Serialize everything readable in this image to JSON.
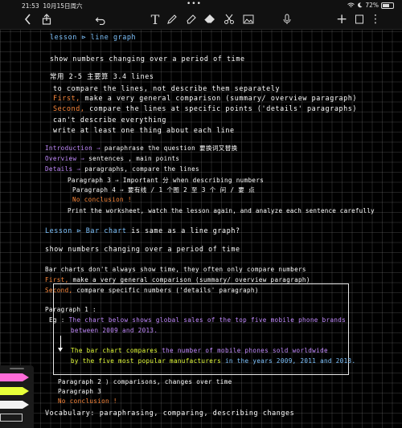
{
  "status": {
    "time": "21:53",
    "date": "10月15日周六",
    "battery": "72%"
  },
  "toolbar": {
    "back_icon": "chevron-left-icon",
    "share_icon": "share-icon",
    "undo_icon": "undo-icon",
    "dots": "•••",
    "text_tool": "T",
    "plus": "+",
    "more": "⋮",
    "page_icon": "square-icon"
  },
  "note": {
    "l1": "lesson ⊳   line graph",
    "l2": "show numbers changing over a period of time",
    "l3": "常用 2-5 主要算 3.4 lines",
    "l4": "to compare the lines, not describe them separately",
    "l5_a": "First,",
    "l5_b": "make a very general comparison (summary/ overview paragraph)",
    "l6_a": "Second,",
    "l6_b": "compare the lines at specific points  ('details' paragraphs)",
    "l7": "can't describe  everything",
    "l8": "write at least one thing  about each line",
    "l9_a": "Introduction ⇒",
    "l9_b": "paraphrase the question  要换词又替换",
    "l10_a": "Overview ⇒",
    "l10_b": "sentences , main points",
    "l11_a": "Details ⇒",
    "l11_b": "paragraphs, compare the lines",
    "l12": "Paragraph 3 ⇒ Important 分 when describing numbers",
    "l13": "Paragraph 4 ⇒ 要有线 / 1 个图   2 至 3 个 问 / 要 点",
    "l14": "No conclusion !",
    "l15": "Print the worksheet,  watch the lesson again, and analyze each sentence carefully",
    "l16_a": "Lesson ⊳  Bar chart",
    "l16_b": "is same as a line graph?",
    "l17": "show numbers changing over a period of time",
    "l18": "Bar charts don't always show time, they often only compare numbers",
    "l19_a": "First,",
    "l19_b": "make a very general comparison (summary/ overview paragraph)",
    "l20_a": "Second,",
    "l20_b": "compare specific numbers  ('details' paragraph)",
    "l21": "Paragraph 1 :",
    "l22_a": "Eg :",
    "l22_b": "The chart below shows  global sales of the top five mobile phone brands",
    "l23": "between 2009 and 2013.",
    "l24_a": "The bar chart compares",
    "l24_b": "the number of mobile phones sold worldwide",
    "l25_a": "by the five most popular manufacturers",
    "l25_b": "in the years 2009, 2011 and 2013.",
    "l26_a": "Paragraph 2",
    "l26_b": "comparisons,  changes over time",
    "l27": "Paragraph 3",
    "l28": "No conclusion !",
    "l29": "Vocabulary: paraphrasing, comparing, describing changes"
  },
  "colors": {
    "blue": "#7fc4ff",
    "orange": "#ff8a3d",
    "purple": "#c38bff",
    "yellow": "#e6ff3a",
    "pink": "#ff6cd9"
  }
}
